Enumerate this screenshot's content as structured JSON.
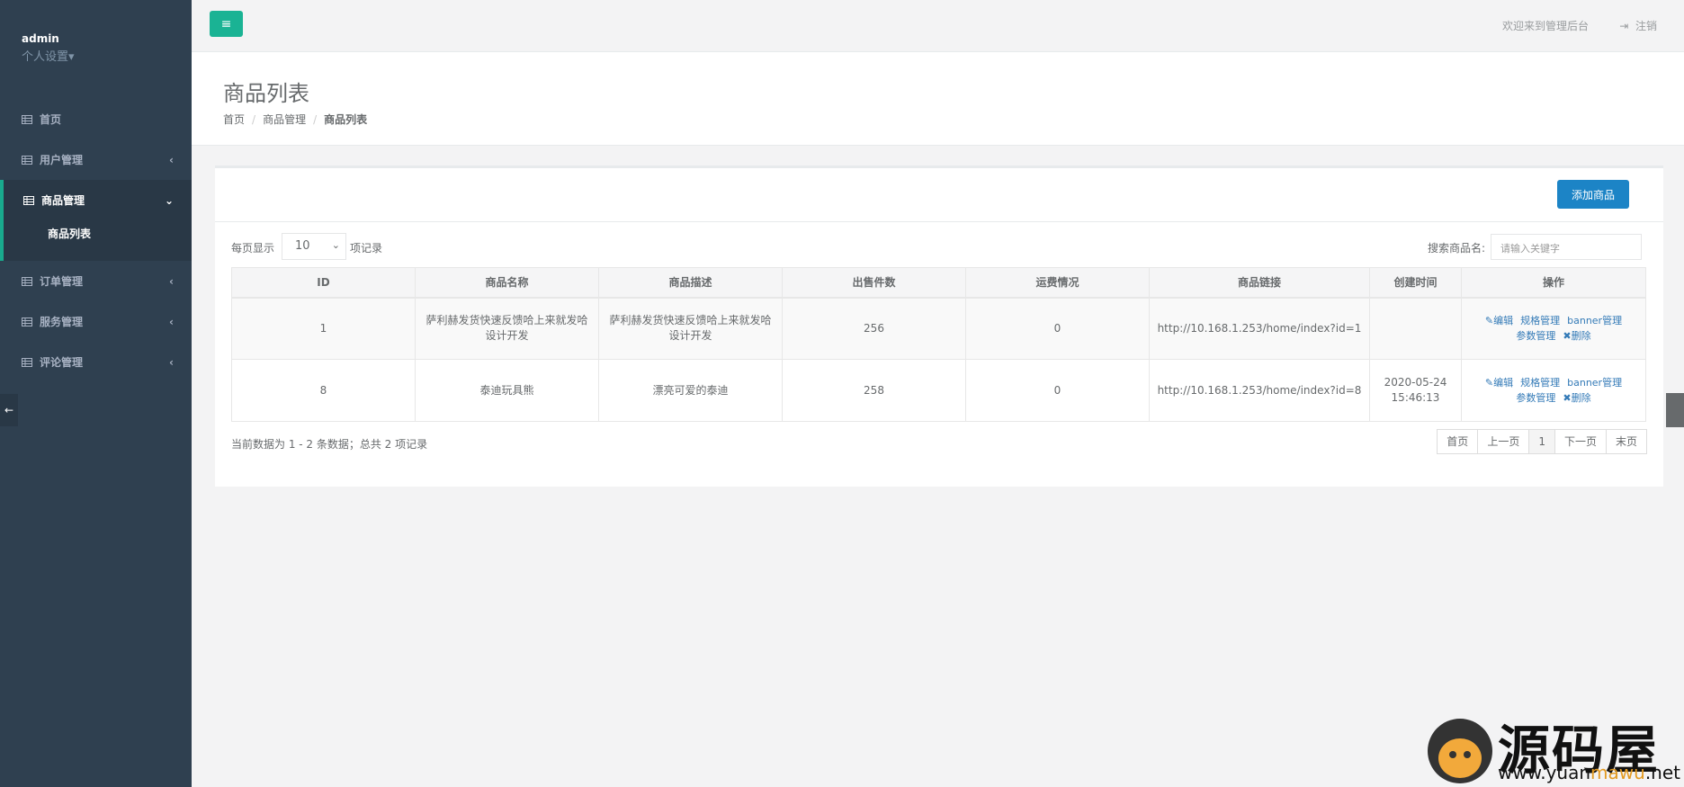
{
  "sidebar": {
    "user": "admin",
    "settings": "个人设置▾",
    "items": [
      {
        "label": "首页"
      },
      {
        "label": "用户管理"
      },
      {
        "label": "商品管理",
        "sub": "商品列表"
      },
      {
        "label": "订单管理"
      },
      {
        "label": "服务管理"
      },
      {
        "label": "评论管理"
      }
    ]
  },
  "topbar": {
    "welcome": "欢迎来到管理后台",
    "logout": "注销",
    "menu_icon": "hamburger-icon"
  },
  "heading": {
    "title": "商品列表",
    "breadcrumb": [
      "首页",
      "商品管理",
      "商品列表"
    ]
  },
  "box": {
    "add_button": "添加商品",
    "length_label_before": "每页显示",
    "length_value": "10",
    "length_label_after": "项记录",
    "search_label": "搜索商品名:",
    "search_placeholder": "请输入关键字",
    "columns": [
      "ID",
      "商品名称",
      "商品描述",
      "出售件数",
      "运费情况",
      "商品链接",
      "创建时间",
      "操作"
    ],
    "rows": [
      {
        "id": "1",
        "name": "萨利赫发货快速反馈哈上来就发哈设计开发",
        "desc": "萨利赫发货快速反馈哈上来就发哈设计开发",
        "sold": "256",
        "freight": "0",
        "link": "http://10.168.1.253/home/index?id=1",
        "created_date": "",
        "created_time": ""
      },
      {
        "id": "8",
        "name": "泰迪玩具熊",
        "desc": "漂亮可爱的泰迪",
        "sold": "258",
        "freight": "0",
        "link": "http://10.168.1.253/home/index?id=8",
        "created_date": "2020-05-24",
        "created_time": "15:46:13"
      }
    ],
    "ops": {
      "edit": "编辑",
      "spec": "规格管理",
      "banner": "banner管理",
      "param": "参数管理",
      "delete": "删除"
    },
    "info": "当前数据为 1 - 2 条数据；总共 2 项记录",
    "pager": [
      "首页",
      "上一页",
      "1",
      "下一页",
      "末页"
    ]
  },
  "watermark": {
    "cn": "源码屋",
    "url_a": "www.",
    "url_b": "yuan",
    "url_c": "mawu",
    "url_d": ".net"
  }
}
